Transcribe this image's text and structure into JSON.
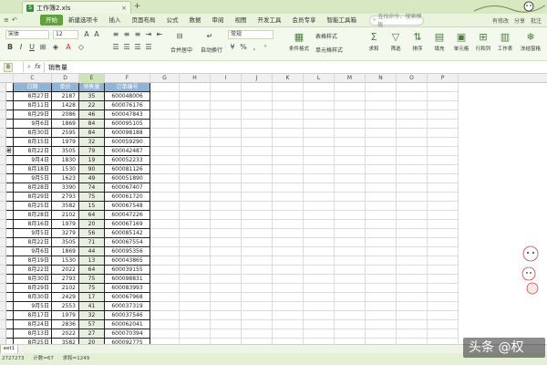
{
  "window": {
    "filename": "工作簿2.xls"
  },
  "menu": {
    "app_label": "",
    "items": [
      "开始",
      "新建选项卡",
      "插入",
      "页面布局",
      "公式",
      "数据",
      "审阅",
      "视图",
      "开发工具",
      "会员专享",
      "智能工具箱"
    ],
    "active_index": 0,
    "search_placeholder": "查找命令、搜索模板",
    "right_items": [
      "有修改",
      "分享",
      "批注"
    ]
  },
  "ribbon": {
    "font_name": "宋体",
    "font_size": "12",
    "number_format": "常规",
    "labels": {
      "merge": "合并居中",
      "wrap": "自动换行",
      "cond_format": "条件格式",
      "table_style": "表格样式",
      "cell_style": "单元格样式",
      "sum": "求和",
      "filter": "筛选",
      "sort": "排序",
      "fill": "填充",
      "cell": "单元格",
      "rowcol": "行和列",
      "sheet": "工作表",
      "freeze": "冻结窗格"
    }
  },
  "formula_bar": {
    "content": "销售量"
  },
  "grid": {
    "columns": [
      "C",
      "D",
      "E",
      "F",
      "G",
      "H",
      "I",
      "J",
      "K",
      "L",
      "M",
      "N",
      "O",
      "P"
    ],
    "selected_column": "E",
    "header_row": {
      "date": "日期",
      "price": "单价",
      "sales": "销售量",
      "order": "订单编号"
    },
    "rows": [
      {
        "frag": "",
        "date": "8月27日",
        "price": "2187",
        "sales": "35",
        "order": "600048006"
      },
      {
        "frag": "",
        "date": "8月11日",
        "price": "1428",
        "sales": "22",
        "order": "600076176"
      },
      {
        "frag": "",
        "date": "8月29日",
        "price": "2086",
        "sales": "46",
        "order": "600047843"
      },
      {
        "frag": "",
        "date": "9月6日",
        "price": "1869",
        "sales": "84",
        "order": "600095105"
      },
      {
        "frag": "",
        "date": "8月30日",
        "price": "2595",
        "sales": "84",
        "order": "600098188"
      },
      {
        "frag": "",
        "date": "8月15日",
        "price": "1979",
        "sales": "32",
        "order": "600059290"
      },
      {
        "frag": "暑",
        "date": "8月22日",
        "price": "3505",
        "sales": "79",
        "order": "600042487"
      },
      {
        "frag": "",
        "date": "9月4日",
        "price": "1830",
        "sales": "19",
        "order": "600052233"
      },
      {
        "frag": "",
        "date": "8月18日",
        "price": "1530",
        "sales": "90",
        "order": "600081126"
      },
      {
        "frag": "",
        "date": "9月5日",
        "price": "1623",
        "sales": "49",
        "order": "600051890"
      },
      {
        "frag": "",
        "date": "8月28日",
        "price": "3390",
        "sales": "74",
        "order": "600067407"
      },
      {
        "frag": "",
        "date": "8月29日",
        "price": "2793",
        "sales": "75",
        "order": "600061720"
      },
      {
        "frag": "",
        "date": "8月25日",
        "price": "3582",
        "sales": "15",
        "order": "600067548"
      },
      {
        "frag": "",
        "date": "8月28日",
        "price": "2102",
        "sales": "64",
        "order": "600047226"
      },
      {
        "frag": "",
        "date": "8月16日",
        "price": "1979",
        "sales": "20",
        "order": "600067169"
      },
      {
        "frag": "",
        "date": "9月5日",
        "price": "3279",
        "sales": "56",
        "order": "600085142"
      },
      {
        "frag": "",
        "date": "8月22日",
        "price": "3505",
        "sales": "71",
        "order": "600067554"
      },
      {
        "frag": "",
        "date": "9月6日",
        "price": "1869",
        "sales": "44",
        "order": "600095356"
      },
      {
        "frag": "",
        "date": "8月19日",
        "price": "1530",
        "sales": "13",
        "order": "600043865"
      },
      {
        "frag": "",
        "date": "8月22日",
        "price": "2022",
        "sales": "64",
        "order": "600039155"
      },
      {
        "frag": "",
        "date": "8月30日",
        "price": "2793",
        "sales": "75",
        "order": "600098831"
      },
      {
        "frag": "",
        "date": "8月29日",
        "price": "2102",
        "sales": "75",
        "order": "600083993"
      },
      {
        "frag": "",
        "date": "8月30日",
        "price": "2429",
        "sales": "17",
        "order": "600067968"
      },
      {
        "frag": "",
        "date": "9月5日",
        "price": "2553",
        "sales": "41",
        "order": "600037319"
      },
      {
        "frag": "",
        "date": "8月17日",
        "price": "1979",
        "sales": "32",
        "order": "600037546"
      },
      {
        "frag": "",
        "date": "8月24日",
        "price": "2836",
        "sales": "57",
        "order": "600062041"
      },
      {
        "frag": "",
        "date": "8月13日",
        "price": "2022",
        "sales": "27",
        "order": "600070394"
      },
      {
        "frag": "",
        "date": "8月25日",
        "price": "3582",
        "sales": "20",
        "order": "600092775"
      },
      {
        "frag": "",
        "date": "9月5日",
        "price": "2022",
        "sales": "77",
        "order": "600047795"
      },
      {
        "frag": "",
        "date": "9月6日",
        "price": "1869",
        "sales": "22",
        "order": "600037441"
      },
      {
        "frag": "",
        "date": "8月20日",
        "price": "1506",
        "sales": "63",
        "order": "600035869"
      }
    ]
  },
  "sheet": {
    "tab": "eet1"
  },
  "status": {
    "sum": "2727273",
    "count": "计数=67",
    "avg": "求和=1249"
  },
  "watermark": {
    "text": "头条 @权"
  },
  "colors": {
    "accent": "#62a03c",
    "header_fill": "#8fb4d9",
    "selection": "#d62b2b"
  }
}
